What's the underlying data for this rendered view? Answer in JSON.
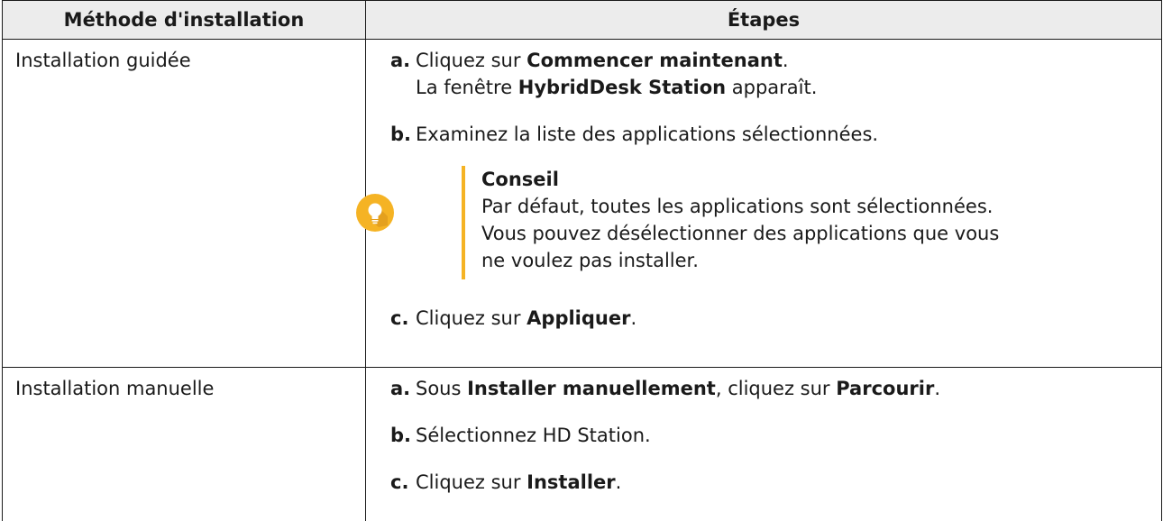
{
  "header": {
    "col1": "Méthode d'installation",
    "col2": "Étapes"
  },
  "rows": [
    {
      "method": "Installation guidée",
      "steps": [
        {
          "letter": "a.",
          "pre": "Cliquez sur ",
          "bold": "Commencer maintenant",
          "post": ".",
          "line2_pre": "La fenêtre ",
          "line2_bold": "HybridDesk Station",
          "line2_post": " apparaît."
        },
        {
          "letter": "b.",
          "text": "Examinez la liste des applications sélectionnées."
        },
        {
          "letter": "c.",
          "pre": "Cliquez sur ",
          "bold": "Appliquer",
          "post": "."
        }
      ],
      "tip": {
        "icon": "lightbulb-icon",
        "title": "Conseil",
        "lines": [
          "Par défaut, toutes les applications sont sélectionnées.",
          "Vous pouvez désélectionner des applications que vous",
          "ne voulez pas installer."
        ]
      }
    },
    {
      "method": "Installation manuelle",
      "steps": [
        {
          "letter": "a.",
          "pre": "Sous ",
          "bold": "Installer manuellement",
          "mid": ", cliquez sur ",
          "bold2": "Parcourir",
          "post": "."
        },
        {
          "letter": "b.",
          "text": "Sélectionnez HD Station."
        },
        {
          "letter": "c.",
          "pre": "Cliquez sur ",
          "bold": "Installer",
          "post": "."
        }
      ]
    }
  ],
  "colors": {
    "header_bg": "#ececec",
    "border": "#1a1a1a",
    "tip_accent": "#f5b324",
    "icon_circle": "#f5b324"
  }
}
